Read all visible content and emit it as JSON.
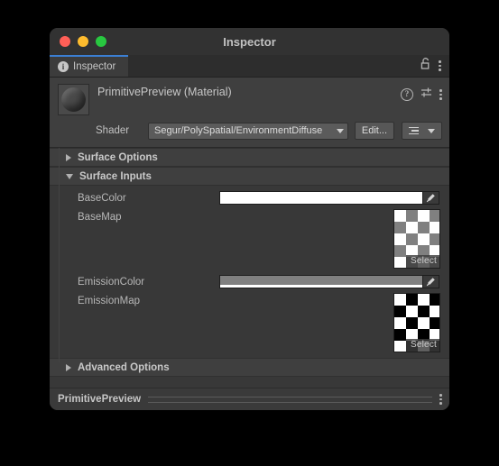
{
  "window": {
    "title": "Inspector",
    "traffic_lights": [
      "close-red",
      "minimize-yellow",
      "maximize-green"
    ]
  },
  "tabbar": {
    "tab_label": "Inspector",
    "tab_icon": "info-icon",
    "lock_icon": "lock-icon",
    "menu_icon": "kebab-menu-icon"
  },
  "material_header": {
    "preview_icon": "material-sphere-preview",
    "title": "PrimitivePreview (Material)",
    "help_icon": "help-icon",
    "settings_icon": "settings-sliders-icon",
    "menu_icon": "kebab-menu-icon",
    "shader_label": "Shader",
    "shader_value": "Segur/PolySpatial/EnvironmentDiffuse",
    "edit_label": "Edit...",
    "preset_icon": "preset-list-icon"
  },
  "sections": [
    {
      "label": "Surface Options",
      "expanded": false
    },
    {
      "label": "Surface Inputs",
      "expanded": true
    },
    {
      "label": "Advanced Options",
      "expanded": false
    }
  ],
  "properties": [
    {
      "label": "BaseColor",
      "type": "color",
      "color": "#ffffff",
      "alpha_color": "#ffffff",
      "eyedropper_icon": "eyedropper-icon"
    },
    {
      "label": "BaseMap",
      "type": "texture",
      "thumbnail": "checkerboard-gray",
      "select_label": "Select"
    },
    {
      "label": "EmissionColor",
      "type": "color",
      "color": "#808080",
      "alpha_color": "#ffffff",
      "eyedropper_icon": "eyedropper-icon"
    },
    {
      "label": "EmissionMap",
      "type": "texture",
      "thumbnail": "checkerboard-black-white",
      "select_label": "Select"
    }
  ],
  "footer": {
    "asset_name": "PrimitivePreview",
    "menu_icon": "kebab-menu-icon"
  },
  "colors": {
    "accent_tab": "#3b7fd4",
    "window_bg": "#383838",
    "header_bg": "#3f3f3f",
    "titlebar_bg": "#323232"
  }
}
